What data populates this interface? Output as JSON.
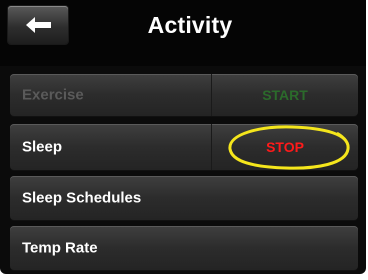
{
  "header": {
    "back_icon": "left-arrow-icon",
    "title": "Activity"
  },
  "rows": [
    {
      "label": "Exercise",
      "action": "START",
      "enabled": false
    },
    {
      "label": "Sleep",
      "action": "STOP",
      "enabled": true
    },
    {
      "label": "Sleep Schedules"
    },
    {
      "label": "Temp Rate"
    }
  ],
  "colors": {
    "start_disabled": "#2b6a2b",
    "stop": "#ff1a1a",
    "highlight_ring": "#f5e61c"
  }
}
